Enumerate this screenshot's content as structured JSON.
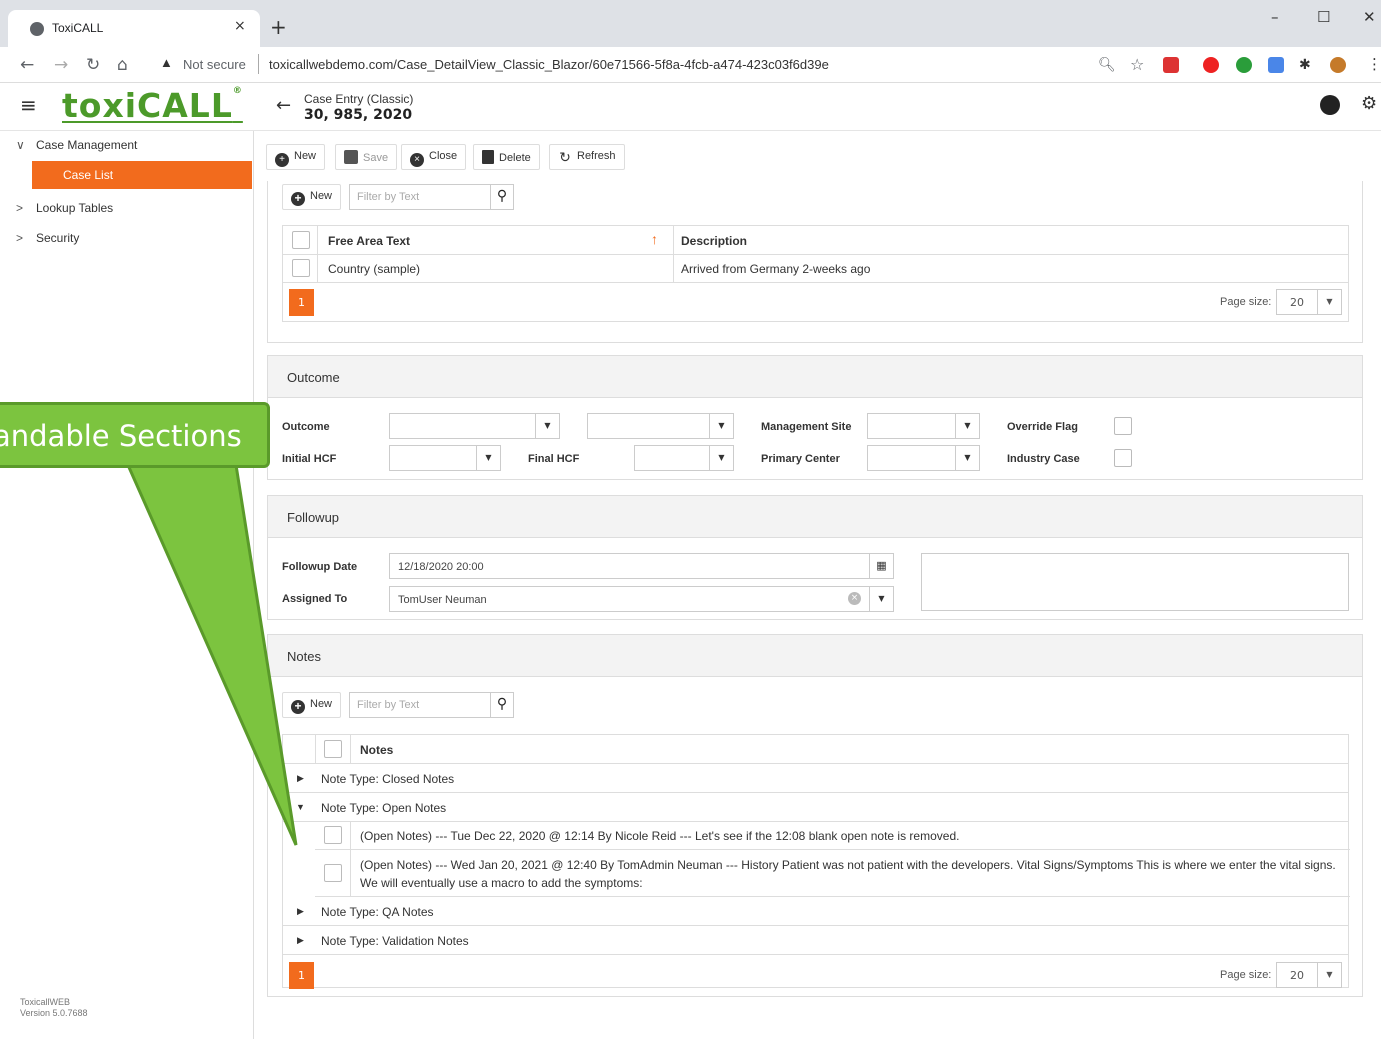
{
  "browser": {
    "tab_title": "ToxiCALL",
    "tab_close": "×",
    "new_tab": "+",
    "minimize": "–",
    "maximize": "☐",
    "close": "✕",
    "not_secure": "Not secure",
    "url": "toxicallwebdemo.com/Case_DetailView_Classic_Blazor/60e71566-5f8a-4fcb-a474-423c03f6d39e"
  },
  "app": {
    "logo": "toxiCALL",
    "header_subtitle": "Case Entry (Classic)",
    "header_title": "30, 985, 2020"
  },
  "sidebar": {
    "items": [
      {
        "label": "Case Management",
        "chev": "∨"
      },
      {
        "label": "Case List"
      },
      {
        "label": "Lookup Tables",
        "chev": ">"
      },
      {
        "label": "Security",
        "chev": ">"
      }
    ],
    "version_line1": "ToxicallWEB",
    "version_line2": "Version 5.0.7688"
  },
  "toolbar": {
    "new": "New",
    "save": "Save",
    "close": "Close",
    "delete": "Delete",
    "refresh": "Refresh"
  },
  "free_area": {
    "new": "New",
    "filter_placeholder": "Filter by Text",
    "col1": "Free Area Text",
    "col2": "Description",
    "rows": [
      {
        "text": "Country (sample)",
        "description": "Arrived from Germany 2-weeks ago"
      }
    ],
    "page": "1",
    "page_size_label": "Page size:",
    "page_size": "20"
  },
  "outcome": {
    "title": "Outcome",
    "outcome_label": "Outcome",
    "initial_hcf_label": "Initial HCF",
    "final_hcf_label": "Final HCF",
    "management_site_label": "Management Site",
    "primary_center_label": "Primary Center",
    "override_flag_label": "Override Flag",
    "industry_case_label": "Industry Case"
  },
  "followup": {
    "title": "Followup",
    "date_label": "Followup Date",
    "date_value": "12/18/2020 20:00",
    "assigned_label": "Assigned To",
    "assigned_value": "TomUser Neuman"
  },
  "notes": {
    "title": "Notes",
    "new": "New",
    "filter_placeholder": "Filter by Text",
    "col": "Notes",
    "group_closed": "Note Type: Closed Notes",
    "group_open": "Note Type: Open Notes",
    "note1": "(Open Notes) --- Tue Dec 22, 2020 @ 12:14 By Nicole Reid --- Let's see if the 12:08 blank open note is removed.",
    "note2": "(Open Notes) --- Wed Jan 20, 2021 @ 12:40 By TomAdmin Neuman --- History Patient was not patient with the developers. Vital Signs/Symptoms This is where we enter the vital signs. We will eventually use a macro to add the symptoms:",
    "group_qa": "Note Type: QA Notes",
    "group_validation": "Note Type: Validation Notes",
    "page": "1",
    "page_size_label": "Page size:",
    "page_size": "20"
  },
  "callout": {
    "text": "andable Sections"
  },
  "colors": {
    "accent": "#f26b1d",
    "logo": "#4c9a2a",
    "callout": "#7cc43f"
  }
}
